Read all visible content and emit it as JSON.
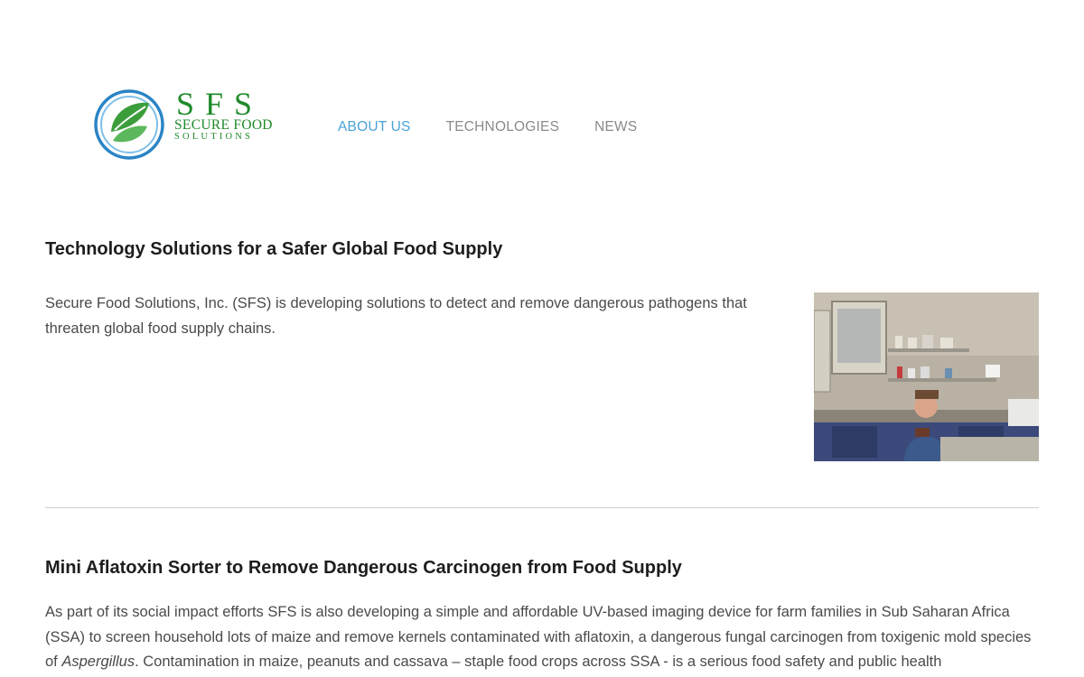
{
  "logo": {
    "abbr": "SFS",
    "line1": "Secure Food",
    "line2": "Solutions",
    "colors": {
      "ring": "#2a84c4",
      "leaf": "#3b9e3b",
      "text": "#1f8a2a"
    }
  },
  "nav": {
    "items": [
      {
        "label": "ABOUT US",
        "active": true
      },
      {
        "label": "TECHNOLOGIES",
        "active": false
      },
      {
        "label": "NEWS",
        "active": false
      }
    ],
    "active_color": "#4aa3d8",
    "color": "#8a8a8a"
  },
  "section1": {
    "title": "Technology Solutions for a Safer Global Food Supply",
    "body": "Secure Food Solutions, Inc. (SFS) is developing solutions to detect and remove dangerous pathogens that threaten global food supply chains."
  },
  "section2": {
    "title": "Mini Aflatoxin Sorter to Remove Dangerous Carcinogen from Food Supply",
    "body_part1": "As part of its social impact efforts SFS is also developing a simple and affordable UV-based imaging device for farm families in Sub Saharan Africa (SSA) to screen household lots of maize and remove kernels contaminated with aflatoxin, a dangerous fungal carcinogen from toxigenic mold species of ",
    "body_italic": "Aspergillus",
    "body_part2": ".  Contamination in maize, peanuts and cassava – staple food crops across SSA - is a serious food safety and public health"
  }
}
